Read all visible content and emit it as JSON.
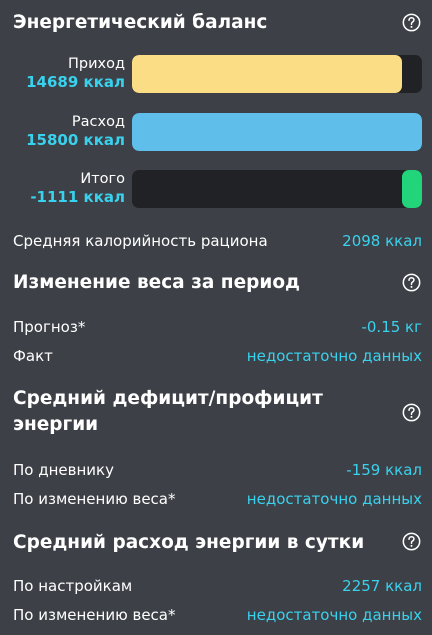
{
  "colors": {
    "background": "#3d4046",
    "accent": "#39d2ee",
    "bar_track": "#212226",
    "income_bar": "#fbdd85",
    "expense_bar": "#5fbfea",
    "total_bar": "#23d57a"
  },
  "energy_balance": {
    "title": "Энергетический баланс",
    "help_icon": "question-circle-icon",
    "bars": [
      {
        "label": "Приход",
        "value": "14689 ккал",
        "fill_fraction": 0.93
      },
      {
        "label": "Расход",
        "value": "15800 ккал",
        "fill_fraction": 1.0
      },
      {
        "label": "Итого",
        "value": "-1111 ккал",
        "fill_fraction": 0.07
      }
    ],
    "avg_calorie": {
      "label": "Средняя калорийность рациона",
      "value": "2098 ккал"
    }
  },
  "weight_change": {
    "title": "Изменение веса за период",
    "rows": [
      {
        "label": "Прогноз*",
        "value": "-0.15 кг"
      },
      {
        "label": "Факт",
        "value": "недостаточно данных"
      }
    ]
  },
  "avg_deficit": {
    "title_line1": "Средний дефицит/профицит",
    "title_line2": "энергии",
    "rows": [
      {
        "label": "По дневнику",
        "value": "-159 ккал"
      },
      {
        "label": "По изменению веса*",
        "value": "недостаточно данных"
      }
    ]
  },
  "avg_expense": {
    "title": "Средний расход энергии в сутки",
    "rows": [
      {
        "label": "По настройкам",
        "value": "2257 ккал"
      },
      {
        "label": "По изменению веса*",
        "value": "недостаточно данных"
      }
    ]
  }
}
